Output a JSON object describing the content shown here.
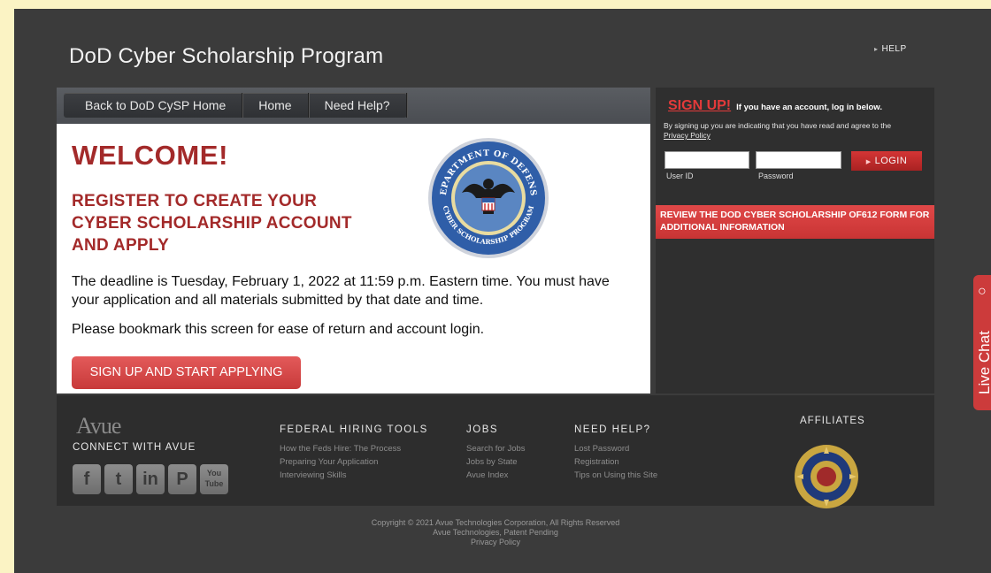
{
  "header": {
    "title": "DoD Cyber Scholarship Program",
    "help": "HELP"
  },
  "nav": {
    "items": [
      "Back to DoD CySP Home",
      "Home",
      "Need Help?"
    ]
  },
  "main": {
    "welcome": "WELCOME!",
    "register": "REGISTER TO CREATE YOUR CYBER SCHOLARSHIP ACCOUNT AND APPLY",
    "deadline": "The deadline is Tuesday, February 1, 2022 at 11:59 p.m. Eastern time. You must have your application and all materials submitted by that date and time.",
    "bookmark": "Please bookmark this screen for ease of return and account login.",
    "signup_button": "SIGN UP AND START APPLYING",
    "seal": {
      "top_text": "DEPARTMENT OF DEFENSE",
      "bottom_text": "CYBER SCHOLARSHIP PROGRAM"
    }
  },
  "login": {
    "signup_link": "SIGN UP!",
    "signup_note": "If you have an account, log in below.",
    "agree_text": "By signing up you are indicating that you have read and agree to the",
    "privacy_link": "Privacy Policy",
    "userid_label": "User ID",
    "password_label": "Password",
    "userid_value": "",
    "password_value": "",
    "login_button": "LOGIN",
    "review_banner": "REVIEW THE DOD CYBER SCHOLARSHIP OF612 FORM FOR ADDITIONAL INFORMATION"
  },
  "footer": {
    "logo": "Avue",
    "connect": "CONNECT WITH AVUE",
    "social": [
      "f",
      "t",
      "in",
      "P",
      "You Tube"
    ],
    "columns": [
      {
        "title": "FEDERAL HIRING TOOLS",
        "links": [
          "How the Feds Hire: The Process",
          "Preparing Your Application",
          "Interviewing Skills"
        ]
      },
      {
        "title": "JOBS",
        "links": [
          "Search for Jobs",
          "Jobs by State",
          "Avue Index"
        ]
      },
      {
        "title": "NEED HELP?",
        "links": [
          "Lost Password",
          "Registration",
          "Tips on Using this Site"
        ]
      }
    ],
    "affiliates": "AFFILIATES",
    "copyright": "Copyright © 2021 Avue Technologies Corporation, All Rights Reserved",
    "patent": "Avue Technologies, Patent Pending",
    "privacy": "Privacy Policy"
  },
  "livechat": {
    "label": "Live Chat"
  },
  "colors": {
    "page_background": "#fbf3c4",
    "accent_red": "#c83a3a",
    "heading_red": "#a32a2a",
    "frame": "#3b3b3b"
  }
}
